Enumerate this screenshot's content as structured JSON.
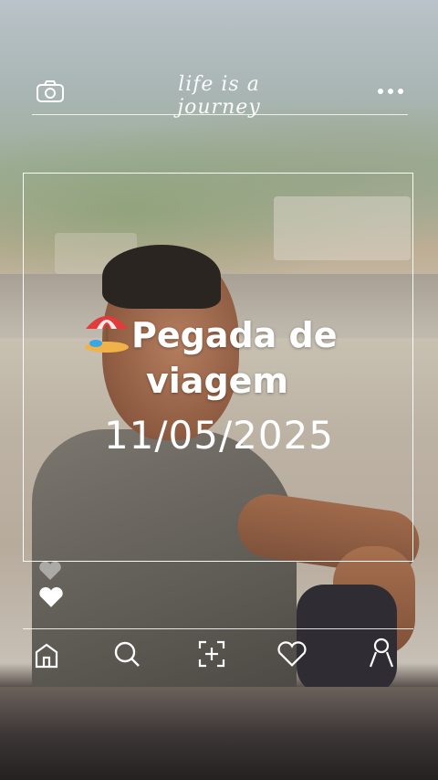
{
  "header": {
    "tagline": "life is a journey",
    "camera_icon": "camera-icon",
    "menu_icon": "more-dots-icon"
  },
  "post": {
    "title_line1": "Pegada de",
    "title_line2": "viagem",
    "title_emoji": "beach-umbrella-emoji",
    "date": "11/05/2025"
  },
  "reactions": {
    "like_icon": "heart-icon"
  },
  "bottom_nav": {
    "items": [
      "home-icon",
      "search-icon",
      "add-post-icon",
      "heart-icon",
      "profile-icon"
    ]
  },
  "colors": {
    "overlay": "#ffffff"
  }
}
